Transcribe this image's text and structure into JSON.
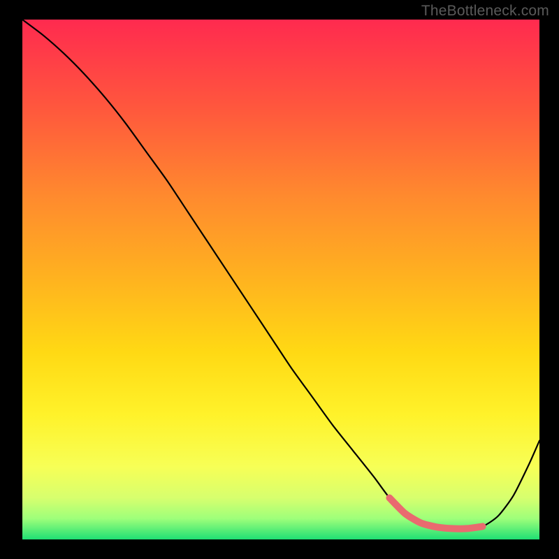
{
  "watermark": "TheBottleneck.com",
  "gradient": {
    "top": "#ff2a4f",
    "c1": "#ff5a3c",
    "c2": "#ff8a2e",
    "c3": "#ffb31f",
    "c4": "#ffd914",
    "c5": "#fff22a",
    "c6": "#f7ff56",
    "c7": "#d7ff6e",
    "c8": "#9eff7a",
    "bottom": "#1fdf74"
  },
  "chart_data": {
    "type": "line",
    "title": "",
    "xlabel": "",
    "ylabel": "",
    "xlim": [
      0,
      100
    ],
    "ylim": [
      0,
      100
    ],
    "series": [
      {
        "name": "bottleneck-curve",
        "x": [
          0,
          4,
          8,
          12,
          16,
          20,
          24,
          28,
          32,
          36,
          40,
          44,
          48,
          52,
          56,
          60,
          64,
          68,
          71,
          74,
          77,
          80,
          83,
          86,
          89,
          92,
          95,
          98,
          100
        ],
        "y": [
          100,
          97,
          93.5,
          89.5,
          85,
          80,
          74.5,
          69,
          63,
          57,
          51,
          45,
          39,
          33,
          27.5,
          22,
          17,
          12,
          8,
          5,
          3.2,
          2.4,
          2.1,
          2.1,
          2.5,
          4.5,
          8.5,
          14.5,
          19
        ]
      },
      {
        "name": "optimal-zone",
        "x": [
          71,
          74,
          77,
          80,
          83,
          86,
          89
        ],
        "y": [
          8,
          5,
          3.2,
          2.4,
          2.1,
          2.1,
          2.5
        ]
      }
    ],
    "annotations": []
  }
}
